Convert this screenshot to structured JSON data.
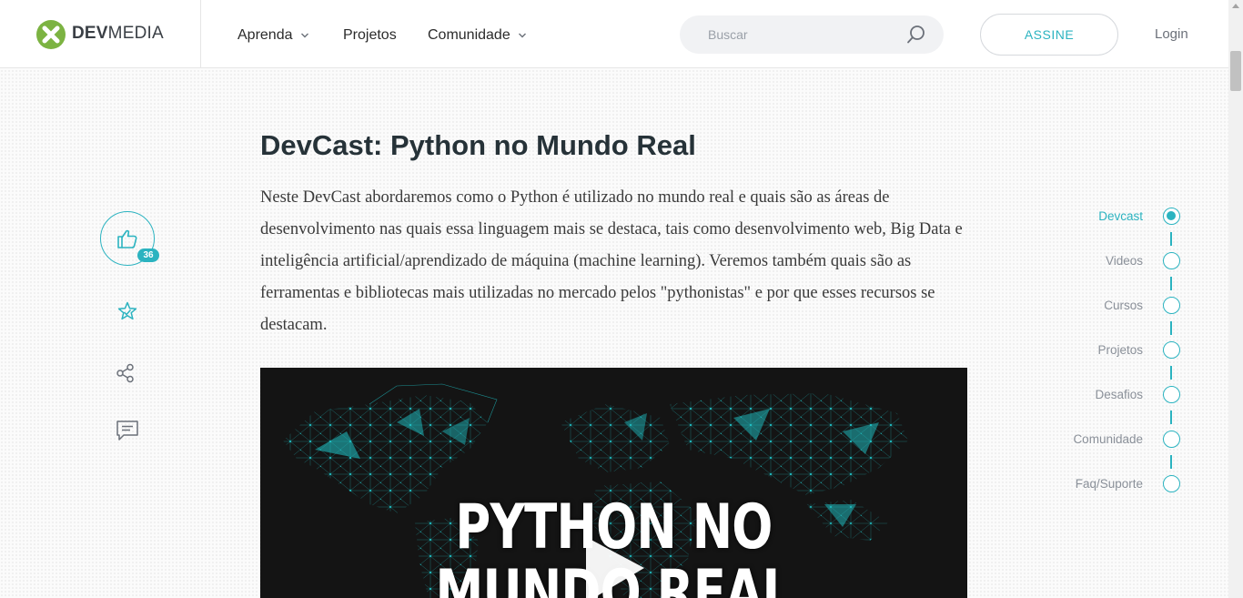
{
  "header": {
    "logo_text_bold": "DEV",
    "logo_text_regular": "MEDIA",
    "nav": [
      {
        "label": "Aprenda",
        "has_dropdown": true
      },
      {
        "label": "Projetos",
        "has_dropdown": false
      },
      {
        "label": "Comunidade",
        "has_dropdown": true
      }
    ],
    "search_placeholder": "Buscar",
    "subscribe_label": "ASSINE",
    "login_label": "Login"
  },
  "sidebar": {
    "like_count": "36"
  },
  "article": {
    "title": "DevCast: Python no Mundo Real",
    "intro": "Neste DevCast abordaremos como o Python é utilizado no mundo real e quais são as áreas de desenvolvimento nas quais essa linguagem mais se destaca, tais como desenvolvimento web, Big Data e inteligência artificial/aprendizado de máquina (machine learning). Veremos também quais são as ferramentas e bibliotecas mais utilizadas no mercado pelos \"pythonistas\" e por que esses recursos se destacam.",
    "video_title_line1": "PYTHON NO",
    "video_title_line2": "MUNDO REAL"
  },
  "timeline": {
    "items": [
      {
        "label": "Devcast",
        "active": true
      },
      {
        "label": "Videos",
        "active": false
      },
      {
        "label": "Cursos",
        "active": false
      },
      {
        "label": "Projetos",
        "active": false
      },
      {
        "label": "Desafios",
        "active": false
      },
      {
        "label": "Comunidade",
        "active": false
      },
      {
        "label": "Faq/Suporte",
        "active": false
      }
    ]
  },
  "colors": {
    "accent": "#2bb3c0",
    "logo_green": "#7cb342",
    "title": "#263238",
    "map_cyan": "#1fc5c9"
  }
}
